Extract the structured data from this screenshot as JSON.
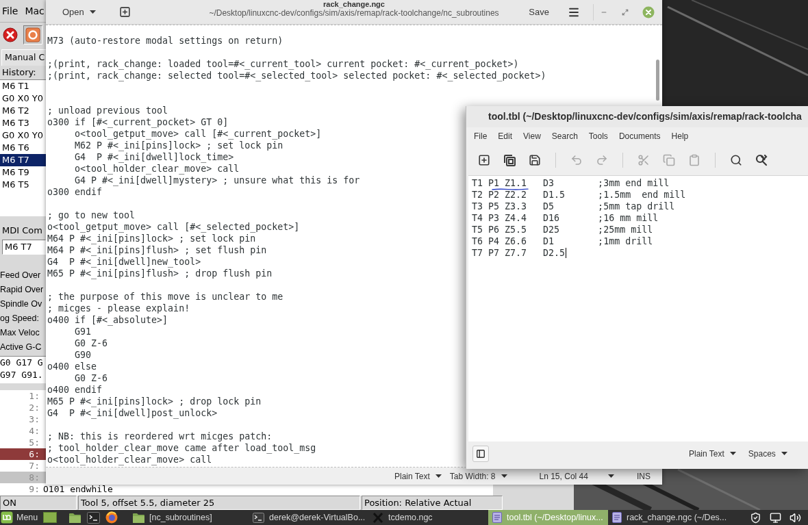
{
  "axis_window": {
    "menu": [
      "File",
      "Mac"
    ],
    "toolbar": [
      {
        "kind": "estop",
        "pressed": false
      },
      {
        "kind": "power",
        "pressed": true
      }
    ],
    "tab": "Manual C",
    "history_label": "History:",
    "history": [
      {
        "command": "M6 T1",
        "selected": false
      },
      {
        "command": "G0 X0 Y0",
        "selected": false
      },
      {
        "command": "M6 T2",
        "selected": false
      },
      {
        "command": "M6 T3",
        "selected": false
      },
      {
        "command": "G0 X0 Y0",
        "selected": false
      },
      {
        "command": "M6 T6",
        "selected": false
      },
      {
        "command": "M6 T7",
        "selected": true
      },
      {
        "command": "M6 T9",
        "selected": false
      },
      {
        "command": "M6 T5",
        "selected": false
      }
    ],
    "mdi_label": "MDI Com",
    "mdi_command": "M6 T7",
    "override_labels": [
      "Feed Over",
      "Rapid Over",
      "Spindle Ov",
      "og Speed:",
      "Max Veloc",
      "Active G-C"
    ],
    "active_codes": [
      "G0 G17 G",
      "G97 G91."
    ],
    "program_lines": [
      {
        "number": "1:",
        "current": false,
        "selected": false
      },
      {
        "number": "2:",
        "current": false,
        "selected": false
      },
      {
        "number": "3:",
        "current": false,
        "selected": false
      },
      {
        "number": "4:",
        "current": false,
        "selected": false
      },
      {
        "number": "5:",
        "current": false,
        "selected": false
      },
      {
        "number": "6:",
        "current": true,
        "selected": false
      },
      {
        "number": "7:",
        "current": false,
        "selected": false
      },
      {
        "number": "8:",
        "current": false,
        "selected": true
      },
      {
        "number": "9:",
        "text": "O101 endwhile",
        "current": false,
        "selected": false
      }
    ],
    "status_bar": [
      "ON",
      "Tool 5, offset 5.5, diameter 25",
      "Position: Relative Actual"
    ]
  },
  "editor_window": {
    "open_label": "Open",
    "title": "rack_change.ngc",
    "path": "~/Desktop/linuxcnc-dev/configs/sim/axis/remap/rack-toolchange/nc_subroutines",
    "save_label": "Save",
    "lines": [
      {
        "kind": "code",
        "text": "M73 (auto-restore modal settings on return)"
      },
      {
        "kind": "blank"
      },
      {
        "kind": "code",
        "text": ";(print, rack_change: loaded tool=#<_current_tool> current pocket: #<_current_pocket>)"
      },
      {
        "kind": "code",
        "text": ";(print, rack_change: selected tool=#<_selected_tool> selected pocket: #<_selected_pocket>)"
      },
      {
        "kind": "blank"
      },
      {
        "kind": "blank"
      },
      {
        "kind": "code",
        "text": "; unload previous tool"
      },
      {
        "kind": "code",
        "text": "o300 if [#<_current_pocket> GT 0]"
      },
      {
        "kind": "code",
        "text": "     o<tool_getput_move> call [#<_current_pocket>]"
      },
      {
        "kind": "code",
        "text": "     M62 P #<_ini[pins]lock> ; set lock pin"
      },
      {
        "kind": "code",
        "text": "     G4  P #<_ini[dwell]lock_time>"
      },
      {
        "kind": "code",
        "text": "     o<tool_holder_clear_move> call"
      },
      {
        "kind": "code",
        "text": "     G4 P #<_ini[dwell]mystery> ; unsure what this is for"
      },
      {
        "kind": "code",
        "text": "o300 endif"
      },
      {
        "kind": "blank"
      },
      {
        "kind": "code",
        "text": "; go to new tool"
      },
      {
        "kind": "code",
        "text": "o<tool_getput_move> call [#<_selected_pocket>]"
      },
      {
        "kind": "code",
        "text": "M64 P #<_ini[pins]lock> ; set lock pin"
      },
      {
        "kind": "code",
        "text": "M64 P #<_ini[pins]flush> ; set flush pin"
      },
      {
        "kind": "code",
        "text": "G4  P #<_ini[dwell]new_tool>"
      },
      {
        "kind": "code",
        "text": "M65 P #<_ini[pins]flush> ; drop flush pin"
      },
      {
        "kind": "blank"
      },
      {
        "kind": "code",
        "text": "; the purpose of this move is unclear to me"
      },
      {
        "kind": "code",
        "text": "; micges - please explain!"
      },
      {
        "kind": "code",
        "text": "o400 if [#<_absolute>]"
      },
      {
        "kind": "code",
        "text": "     G91"
      },
      {
        "kind": "code",
        "text": "     G0 Z-6"
      },
      {
        "kind": "code",
        "text": "     G90"
      },
      {
        "kind": "code",
        "text": "o400 else"
      },
      {
        "kind": "code",
        "text": "     G0 Z-6"
      },
      {
        "kind": "code",
        "text": "o400 endif"
      },
      {
        "kind": "code",
        "text": "M65 P #<_ini[pins]lock> ; drop lock pin"
      },
      {
        "kind": "code",
        "text": "G4  P #<_ini[dwell]post_unlock>"
      },
      {
        "kind": "blank"
      },
      {
        "kind": "code",
        "text": "; NB: this is reordered wrt micges patch:"
      },
      {
        "kind": "code",
        "text": "; tool_holder_clear_move came after load_tool_msg"
      },
      {
        "kind": "code",
        "text": "o<tool_holder_clear_move> call"
      }
    ],
    "status": {
      "language": "Plain Text",
      "tab_width": "Tab Width: 8",
      "cursor_position": "Ln 15, Col 44",
      "mode": "INS"
    }
  },
  "tool_table_window": {
    "title": "tool.tbl (~/Desktop/linuxcnc-dev/configs/sim/axis/remap/rack-toolcha",
    "menu": [
      "File",
      "Edit",
      "View",
      "Search",
      "Tools",
      "Documents",
      "Help"
    ],
    "toolbar": [
      {
        "kind": "new",
        "disabled": false
      },
      {
        "kind": "open",
        "disabled": false
      },
      {
        "kind": "save",
        "disabled": false
      },
      {
        "kind": "separator"
      },
      {
        "kind": "undo",
        "disabled": true
      },
      {
        "kind": "redo",
        "disabled": true
      },
      {
        "kind": "separator"
      },
      {
        "kind": "cut",
        "disabled": true
      },
      {
        "kind": "copy",
        "disabled": true
      },
      {
        "kind": "paste",
        "disabled": true
      },
      {
        "kind": "separator"
      },
      {
        "kind": "search",
        "disabled": false
      },
      {
        "kind": "replace",
        "disabled": false
      }
    ],
    "lines": [
      {
        "text": "T1 P1 Z1.1   D3        ;3mm end mill",
        "cursor": false
      },
      {
        "text": "T2 P2 Z2.2   D1.5      ;1.5mm  end mill",
        "cursor": false
      },
      {
        "text": "T3 P5 Z3.3   D5        ;5mm tap drill",
        "cursor": false
      },
      {
        "text": "T4 P3 Z4.4   D16       ;16 mm mill",
        "cursor": false
      },
      {
        "text": "T5 P6 Z5.5   D25       ;25mm mill",
        "cursor": false
      },
      {
        "text": "T6 P4 Z6.6   D1        ;1mm drill",
        "cursor": false
      },
      {
        "text": "T7 P7 Z7.7   D2.5",
        "cursor": true
      }
    ],
    "status": {
      "language": "Plain Text",
      "indent": "Spaces"
    }
  },
  "taskbar": {
    "menu_label": "Menu",
    "tasks": [
      {
        "label": "[nc_subroutines]",
        "kind": "folder",
        "selected": false
      },
      {
        "label": "derek@derek-VirtualBo...",
        "kind": "terminal",
        "selected": false
      },
      {
        "label": "tcdemo.ngc",
        "kind": "x11",
        "selected": false
      },
      {
        "label": "tool.tbl (~/Desktop/linux...",
        "kind": "editor",
        "selected": true
      },
      {
        "label": "rack_change.ngc (~/Des...",
        "kind": "editor",
        "selected": false
      }
    ]
  }
}
